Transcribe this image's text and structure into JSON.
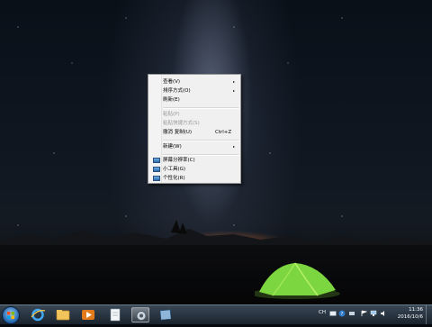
{
  "context_menu": {
    "view": "查看(V)",
    "sort_by": "排序方式(O)",
    "refresh": "刷新(E)",
    "paste": "粘贴(P)",
    "paste_shortcut": "粘贴快捷方式(S)",
    "undo_copy": "撤消 复制(U)",
    "undo_copy_shortcut": "Ctrl+Z",
    "new": "新建(W)",
    "screen_resolution": "屏幕分辨率(C)",
    "gadgets": "小工具(G)",
    "personalize": "个性化(R)",
    "submenu_arrow": "▸"
  },
  "taskbar": {
    "pinned_icons": [
      "ie-icon",
      "explorer-icon",
      "media-player-icon",
      "document-icon",
      "app-icon",
      "window-icon"
    ],
    "tray": {
      "ime": "CH"
    },
    "clock": {
      "time": "11:36",
      "date": "2016/10/6"
    }
  },
  "colors": {
    "menu_bg": "#f0f0f0",
    "taskbar": "#2a3a48",
    "tent": "#7cd640"
  }
}
